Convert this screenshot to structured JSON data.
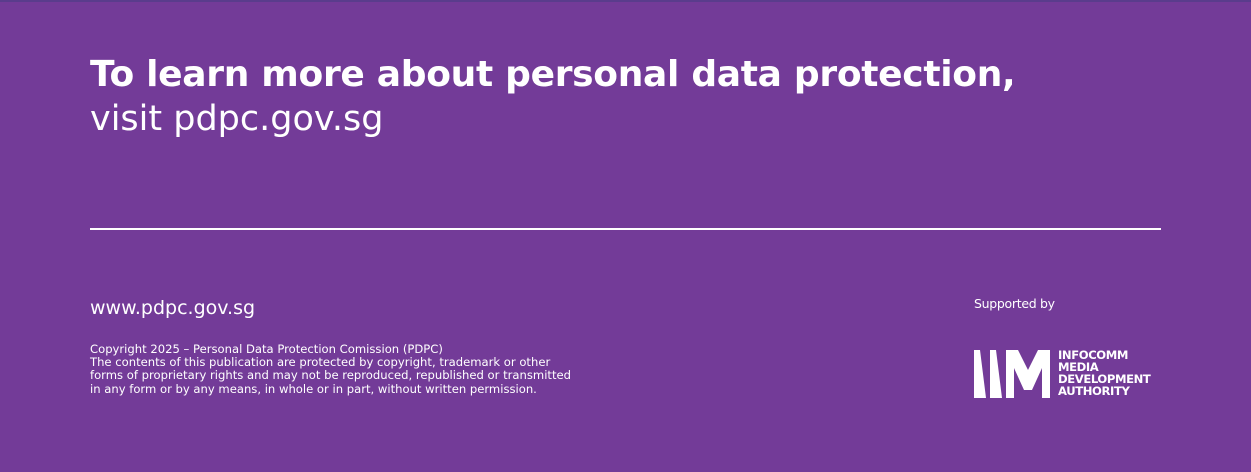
{
  "headline": {
    "bold": "To learn more about personal data protection,",
    "light": "visit pdpc.gov.sg"
  },
  "footer": {
    "website": "www.pdpc.gov.sg",
    "copyright_lines": [
      "Copyright 2025 – Personal Data Protection Comission (PDPC)",
      "The contents of this publication are protected by copyright, trademark or other",
      "forms of proprietary rights and may not be reproduced, republished or transmitted",
      "in any form or by any means, in whole or in part, without written permission."
    ]
  },
  "sponsor": {
    "label": "Supported by",
    "logo_lines": [
      "INFOCOMM",
      "MEDIA",
      "DEVELOPMENT",
      "AUTHORITY"
    ],
    "logo_icon": "imda-logo-icon"
  },
  "colors": {
    "background": "#733b98",
    "text": "#ffffff"
  }
}
